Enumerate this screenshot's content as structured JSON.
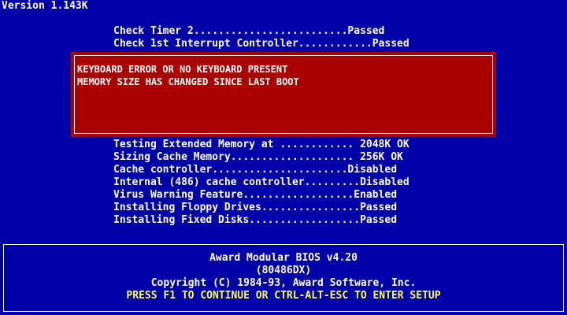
{
  "version": "Version 1.143K",
  "checks_top": [
    "Check Timer 2.........................Passed",
    "Check 1st Interrupt Controller............Passed"
  ],
  "error_messages": [
    "KEYBOARD ERROR OR NO KEYBOARD PRESENT",
    "MEMORY SIZE HAS CHANGED SINCE LAST BOOT"
  ],
  "checks_bottom": [
    "Testing Extended Memory at ............ 2048K OK",
    "Sizing Cache Memory.................... 256K OK",
    "Cache controller......................Disabled",
    "Internal (486) cache controller.........Disabled",
    "Virus Warning Feature..................Enabled",
    "Installing Floppy Drives................Passed",
    "Installing Fixed Disks..................Passed"
  ],
  "footer": {
    "bios_name": "Award Modular BIOS v4.20",
    "cpu": "(80486DX)",
    "copyright": "Copyright (C) 1984-93, Award Software, Inc.",
    "prompt": "PRESS F1 TO CONTINUE OR CTRL-ALT-ESC TO ENTER SETUP"
  },
  "colors": {
    "background": "#0000aa",
    "error_box": "#aa0000",
    "text": "#ffffff",
    "prompt": "#ffff55"
  }
}
